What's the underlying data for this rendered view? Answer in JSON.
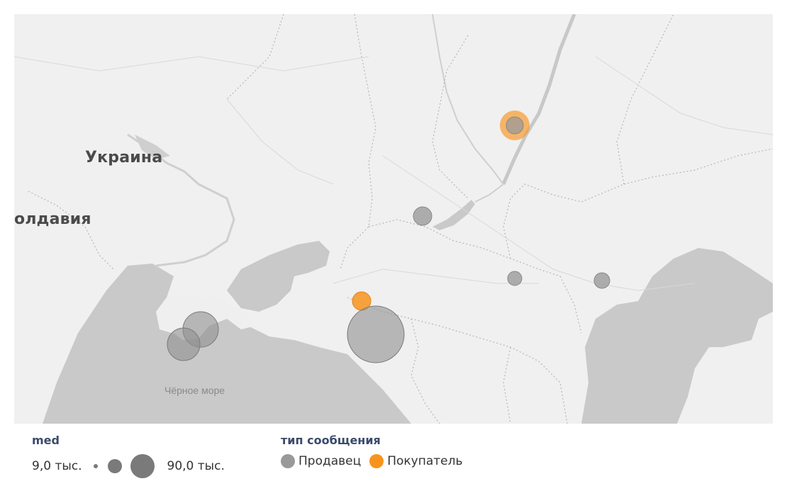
{
  "map": {
    "labels": {
      "ukraine": "Украина",
      "moldova": "олдавия",
      "sea": "Чёрное море"
    },
    "markers": [
      {
        "type": "seller",
        "color": "#999999",
        "size_rank": "small-medium"
      },
      {
        "type": "buyer",
        "color": "#f7941d",
        "size_rank": "medium"
      },
      {
        "type": "seller",
        "color": "#999999",
        "size_rank": "small"
      },
      {
        "type": "seller",
        "color": "#999999",
        "size_rank": "small"
      },
      {
        "type": "buyer",
        "color": "#f7941d",
        "size_rank": "small"
      },
      {
        "type": "seller",
        "color": "#999999",
        "size_rank": "large"
      },
      {
        "type": "seller",
        "color": "#999999",
        "size_rank": "medium"
      },
      {
        "type": "seller",
        "color": "#999999",
        "size_rank": "medium"
      }
    ]
  },
  "legend": {
    "size": {
      "title": "med",
      "min_label": "9,0 тыс.",
      "max_label": "90,0 тыс."
    },
    "color": {
      "title": "тип сообщения",
      "items": [
        {
          "label": "Продавец",
          "color": "#999999"
        },
        {
          "label": "Покупатель",
          "color": "#f7941d"
        }
      ]
    }
  }
}
